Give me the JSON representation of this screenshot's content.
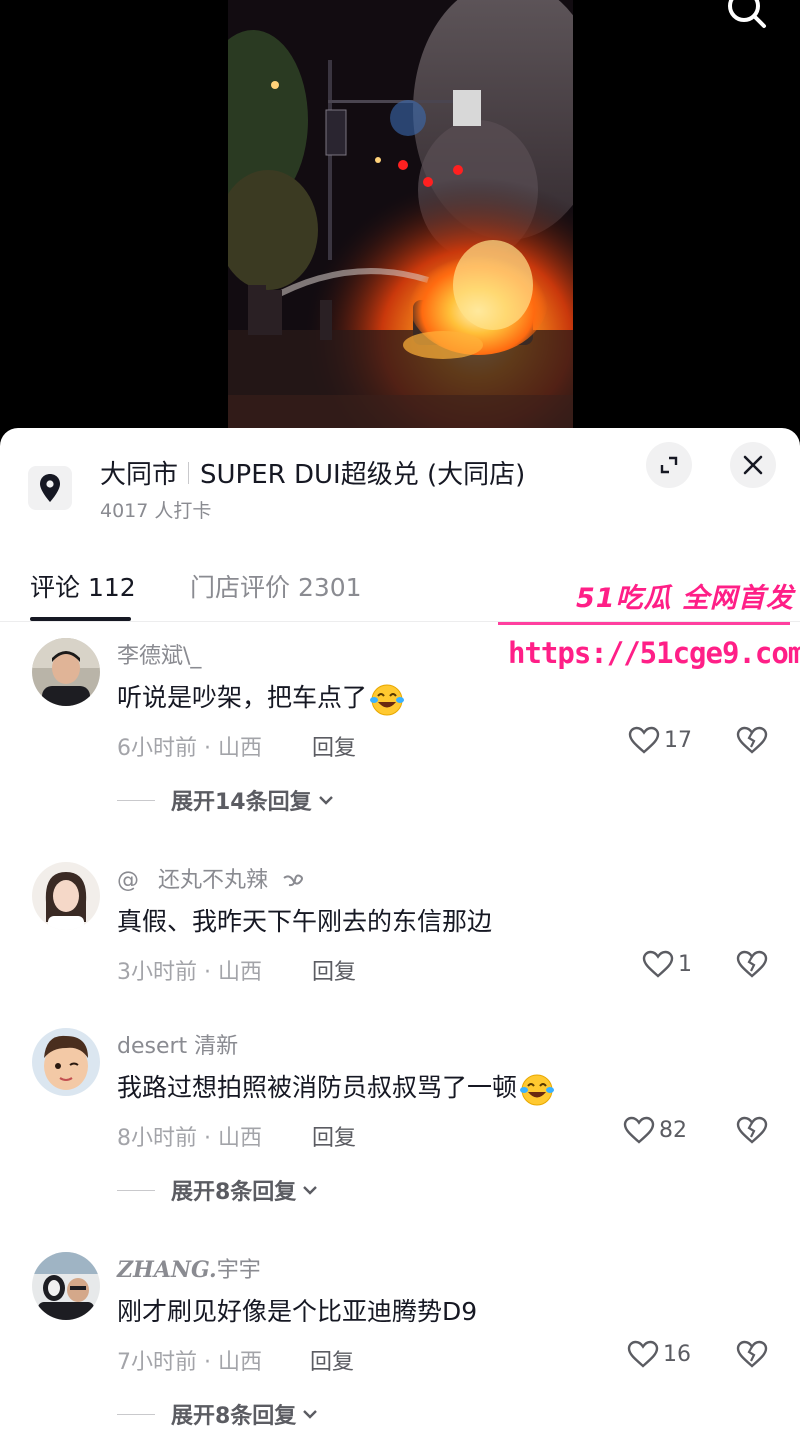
{
  "icons": {
    "search": "search-icon",
    "location": "location-pin-icon",
    "expand": "expand-icon",
    "close": "close-icon",
    "like": "heart-icon",
    "dislike": "broken-heart-icon",
    "chevron": "chevron-down-icon",
    "emoji": "laugh-cry-emoji"
  },
  "colors": {
    "text_primary": "#161823",
    "text_secondary": "#8a8b91",
    "watermark": "#ff1f87"
  },
  "poi": {
    "city": "大同市",
    "name": "SUPER DUI超级兑 (大同店)",
    "checkins": "4017 人打卡"
  },
  "tabs": {
    "comments_label": "评论 112",
    "reviews_label": "门店评价 2301",
    "active": "comments"
  },
  "comments": [
    {
      "user": "李德斌\\_",
      "text": "听说是吵架，把车点了",
      "meta": "6小时前 · 山西",
      "reply": "回复",
      "likes": "17",
      "expand": "展开14条回复"
    },
    {
      "user_prefix": "@",
      "user": "还丸不丸辣",
      "text": "真假、我昨天下午刚去的东信那边",
      "meta": "3小时前 · 山西",
      "reply": "回复",
      "likes": "1"
    },
    {
      "user": "desert 清新",
      "text": "我路过想拍照被消防员叔叔骂了一顿",
      "meta": "8小时前 · 山西",
      "reply": "回复",
      "likes": "82",
      "expand": "展开8条回复"
    },
    {
      "user_styled": "ZHANG.",
      "user": "宇宇",
      "text": "刚才刷见好像是个比亚迪腾势D9",
      "meta": "7小时前 · 山西",
      "reply": "回复",
      "likes": "16",
      "expand": "展开8条回复"
    }
  ],
  "watermark": {
    "brand": "51吃瓜 全网首发",
    "url": "https://51cge9.com"
  }
}
